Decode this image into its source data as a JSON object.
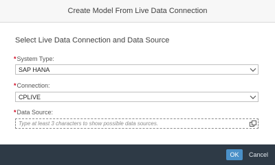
{
  "dialog": {
    "title": "Create Model From Live Data Connection",
    "section_title": "Select Live Data Connection and Data Source",
    "system_type": {
      "label": "System Type:",
      "required_marker": "*",
      "value": "SAP HANA"
    },
    "connection": {
      "label": "Connection:",
      "required_marker": "*",
      "value": "CPLIVE"
    },
    "data_source": {
      "label": "Data Source:",
      "required_marker": "*",
      "placeholder": "Type at least 3 characters to show possible data sources."
    },
    "footer": {
      "ok_label": "OK",
      "cancel_label": "Cancel"
    }
  },
  "colors": {
    "accent": "#4a90c8",
    "footer_bg": "#2e3a46",
    "required": "#d0021b"
  },
  "icons": {
    "dropdown": "chevron-down-icon",
    "value_help": "value-help-icon"
  }
}
